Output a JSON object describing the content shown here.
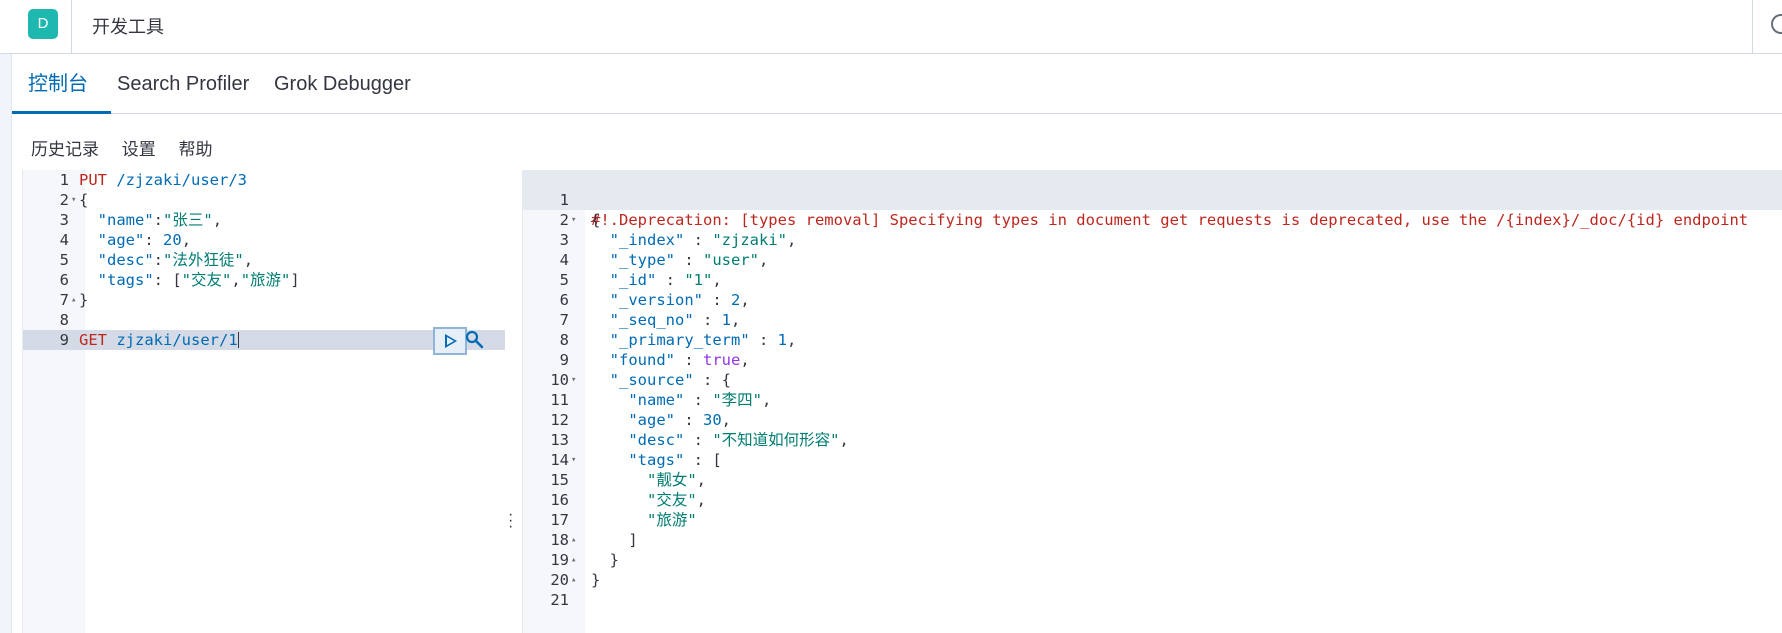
{
  "header": {
    "logo_letter": "D",
    "title": "开发工具"
  },
  "tabs": [
    {
      "label": "控制台",
      "active": true
    },
    {
      "label": "Search Profiler",
      "active": false
    },
    {
      "label": "Grok Debugger",
      "active": false
    }
  ],
  "submenu": {
    "history": "历史记录",
    "settings": "设置",
    "help": "帮助"
  },
  "request_editor": {
    "line_numbers": [
      "1",
      "2",
      "3",
      "4",
      "5",
      "6",
      "7",
      "8",
      "9"
    ],
    "lines": [
      "PUT /zjzaki/user/3",
      "{",
      "  \"name\":\"张三\",",
      "  \"age\": 20,",
      "  \"desc\":\"法外狂徒\",",
      "  \"tags\": [\"交友\",\"旅游\"]",
      "}",
      "",
      "GET zjzaki/user/1"
    ]
  },
  "response_editor": {
    "deprecation_line1": "#! Deprecation: [types removal] Specifying types in document get requests is deprecated, use the /{index}/_doc/{id} endpoint",
    "deprecation_line2": "  .",
    "line_numbers": [
      "2",
      "3",
      "4",
      "5",
      "6",
      "7",
      "8",
      "9",
      "10",
      "11",
      "12",
      "13",
      "14",
      "15",
      "16",
      "17",
      "18",
      "19",
      "20",
      "21"
    ],
    "lines": [
      "{",
      "  \"_index\" : \"zjzaki\",",
      "  \"_type\" : \"user\",",
      "  \"_id\" : \"1\",",
      "  \"_version\" : 2,",
      "  \"_seq_no\" : 1,",
      "  \"_primary_term\" : 1,",
      "  \"found\" : true,",
      "  \"_source\" : {",
      "    \"name\" : \"李四\",",
      "    \"age\" : 30,",
      "    \"desc\" : \"不知道如何形容\",",
      "    \"tags\" : [",
      "      \"靓女\",",
      "      \"交友\",",
      "      \"旅游\"",
      "    ]",
      "  }",
      "}",
      ""
    ]
  },
  "colors": {
    "accent": "#006bb4",
    "logo": "#1eb8b0",
    "method": "#bd271e",
    "string": "#017d73"
  },
  "icons": {
    "run": "play-icon",
    "wrench": "wrench-icon",
    "resize": "vertical-dots-icon"
  }
}
